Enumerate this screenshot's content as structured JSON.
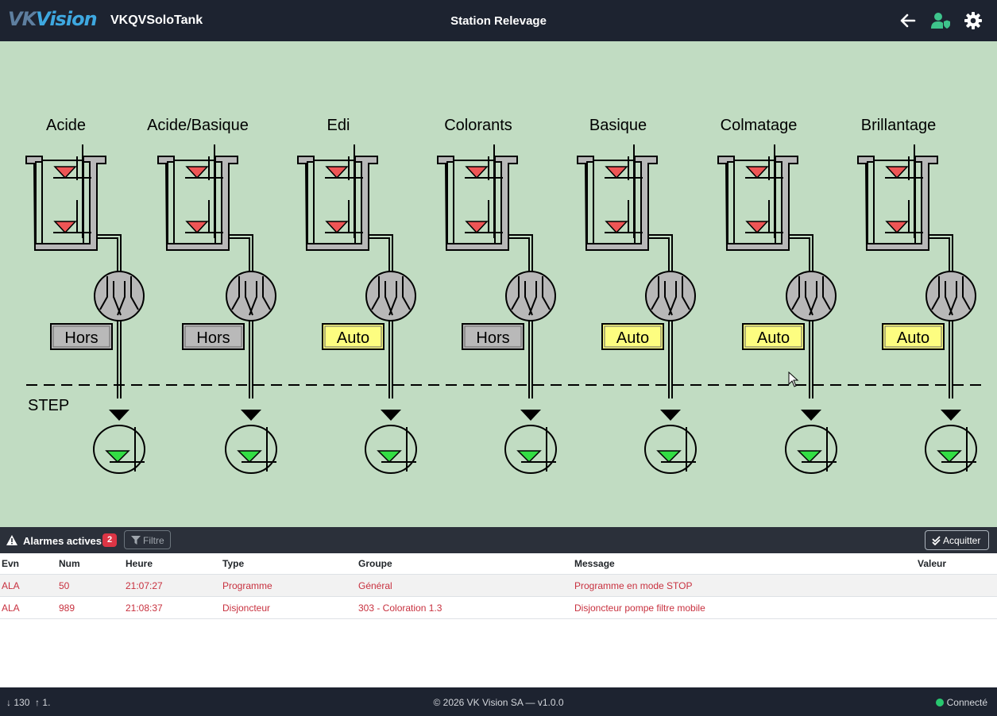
{
  "header": {
    "logo_text_vk": "VK",
    "logo_text_vision": "Vision",
    "app_name": "VKQVSoloTank",
    "page_title": "Station Relevage",
    "icons": [
      "arrow-left-icon",
      "user-shield-icon",
      "gear-icon"
    ],
    "colors": {
      "background": "#1d2330",
      "user_icon": "#3ec48c"
    }
  },
  "synoptic": {
    "background": "#c1dcc2",
    "step_label": "STEP",
    "tanks": [
      {
        "label": "Acide",
        "mode": "Hors"
      },
      {
        "label": "Acide/Basique",
        "mode": "Hors"
      },
      {
        "label": "Edi",
        "mode": "Auto"
      },
      {
        "label": "Colorants",
        "mode": "Hors"
      },
      {
        "label": "Basique",
        "mode": "Auto"
      },
      {
        "label": "Colmatage",
        "mode": "Auto"
      },
      {
        "label": "Brillantage",
        "mode": "Auto"
      }
    ],
    "mode_colors": {
      "Hors": "#b9b9b9",
      "Auto": "#fdfd80"
    }
  },
  "alarms": {
    "title": "Alarmes actives",
    "count": "2",
    "filter_label": "Filtre",
    "ack_label": "Acquitter",
    "columns": [
      "Evn",
      "Num",
      "Heure",
      "Type",
      "Groupe",
      "Message",
      "Valeur"
    ],
    "rows": [
      [
        "ALA",
        "50",
        "21:07:27",
        "Programme",
        "Général",
        "Programme en mode STOP",
        ""
      ],
      [
        "ALA",
        "989",
        "21:08:37",
        "Disjoncteur",
        "303 - Coloration 1.3",
        "Disjoncteur pompe filtre mobile",
        ""
      ]
    ],
    "text_color": "#c8313f"
  },
  "footer": {
    "down_count": "130",
    "up_count": "1.",
    "copyright": "© 2026 VK Vision SA — v1.0.0",
    "status": "Connecté",
    "status_color": "#28c76f"
  }
}
